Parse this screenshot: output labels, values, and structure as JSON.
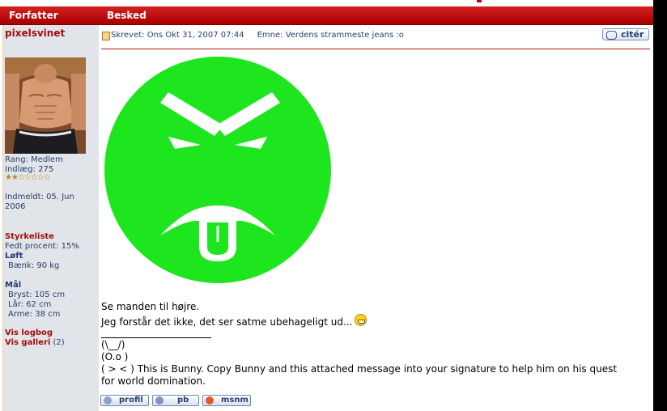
{
  "header": {
    "author_label": "Forfatter",
    "message_label": "Besked"
  },
  "author": {
    "username": "pixelsvinet",
    "rank": "Rang: Medlem",
    "posts": "Indlæg: 275",
    "stars": "★★☆☆☆☆☆",
    "joined": "Indmeldt: 05. Jun",
    "joined_year": "2006",
    "strength_heading": "Styrkeliste",
    "fat_percent": "Fedt procent: 15%",
    "lift_heading": "Løft",
    "bench": "Bænk: 90 kg",
    "measure_heading": "Mål",
    "chest": "Bryst: 105 cm",
    "thigh": "Lår: 62 cm",
    "arms": "Arme: 38 cm",
    "logbook_link": "Vis logbog",
    "gallery_link": "Vis galleri",
    "gallery_count": "(2)"
  },
  "post": {
    "written": "Skrevet: Ons Okt 31, 2007 07:44",
    "subject": "Emne: Verdens strammeste jeans :o",
    "quote_label": "citér",
    "line1": "Se manden til højre.",
    "line2": "Jeg forstår det ikke, det ser satme ubehageligt ud...",
    "smiley_icon": "grinning-smiley-icon"
  },
  "signature": {
    "bunny1": "(\\__/)",
    "bunny2": "(O.o )",
    "bunny3": "( > < ) This is Bunny. Copy Bunny and this attached message into your signature to help him on his quest",
    "bunny4": "for world domination."
  },
  "buttons": {
    "profile": "profil",
    "pm": "pb",
    "msnm": "msnm"
  },
  "colors": {
    "header_red": "#c41414",
    "smiley_green": "#1ee61e",
    "sidebar_bg": "#e1e4e8",
    "link_red": "#a30d0d"
  }
}
